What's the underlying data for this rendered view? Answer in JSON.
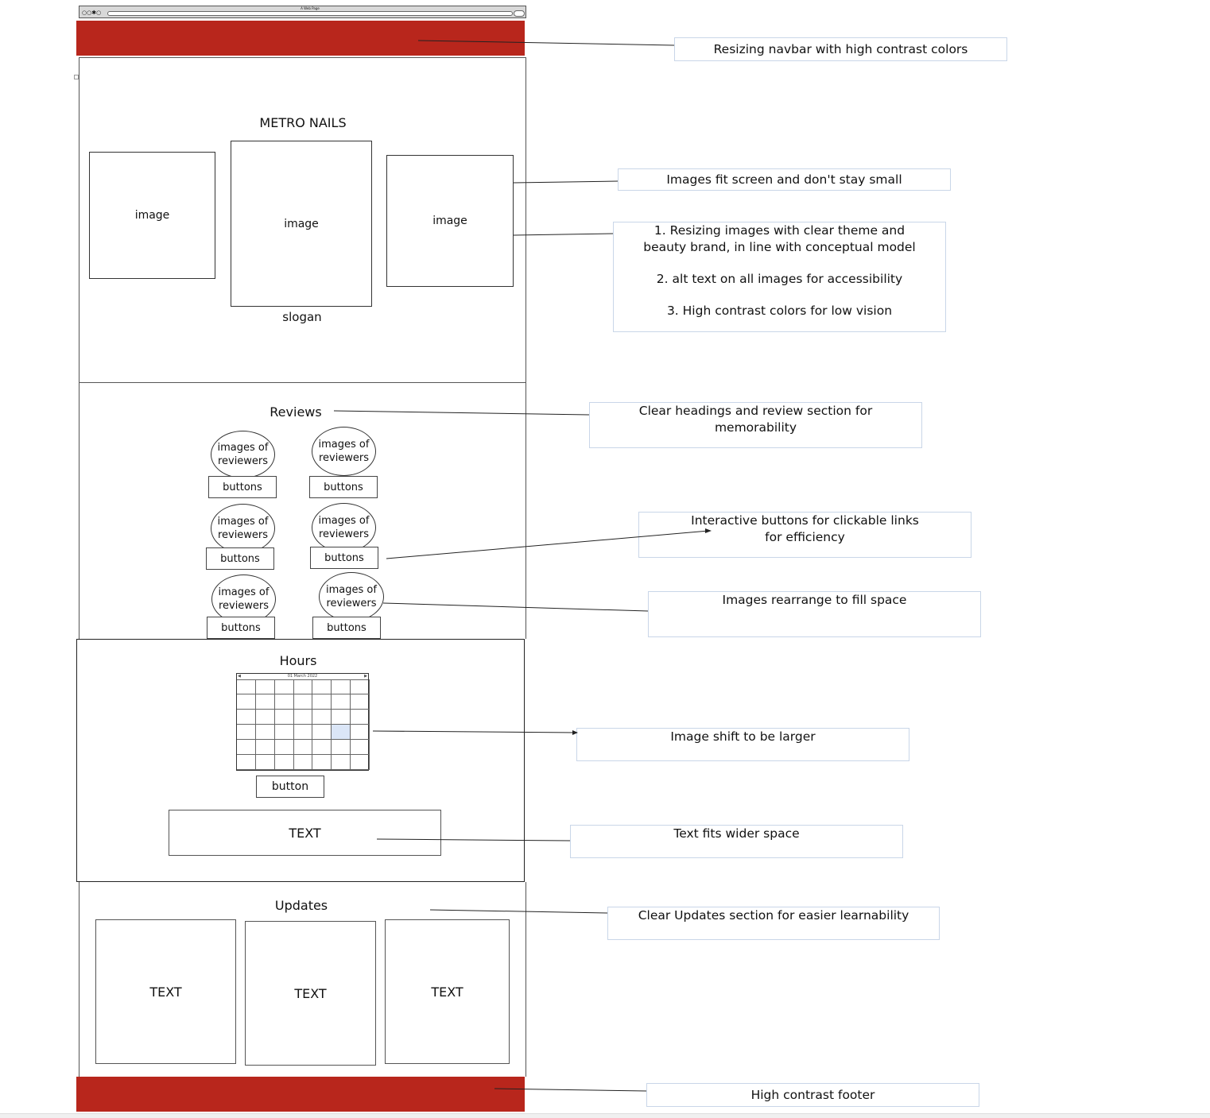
{
  "wireframe": {
    "browser": {
      "title": "A Web Page"
    },
    "hero": {
      "title": "METRO NAILS",
      "image_label": "image",
      "slogan": "slogan"
    },
    "reviews": {
      "title": "Reviews",
      "reviewer_line1": "images of",
      "reviewer_line2": "reviewers",
      "button_label": "buttons"
    },
    "hours": {
      "title": "Hours",
      "calendar_month": "01 March 2022",
      "button_label": "button",
      "text_label": "TEXT"
    },
    "updates": {
      "title": "Updates",
      "text_label": "TEXT"
    }
  },
  "annotations": {
    "navbar": "Resizing navbar with high contrast colors",
    "images_fit": "Images fit screen and don't stay small",
    "images_list": [
      "1. Resizing images with clear theme and beauty brand, in line with conceptual model",
      "2. alt text on all images for accessibility",
      "3. High contrast colors for low vision"
    ],
    "reviews_heading": "Clear headings and review section for memorability",
    "buttons": "Interactive buttons for clickable links for efficiency",
    "rearrange": "Images rearrange to fill space",
    "calendar": "Image shift to be larger",
    "text_fit": "Text fits wider space",
    "updates": "Clear Updates section for easier learnability",
    "footer": "High contrast footer"
  },
  "colors": {
    "brand_red": "#b8261c",
    "note_border": "#c9d6e8"
  }
}
